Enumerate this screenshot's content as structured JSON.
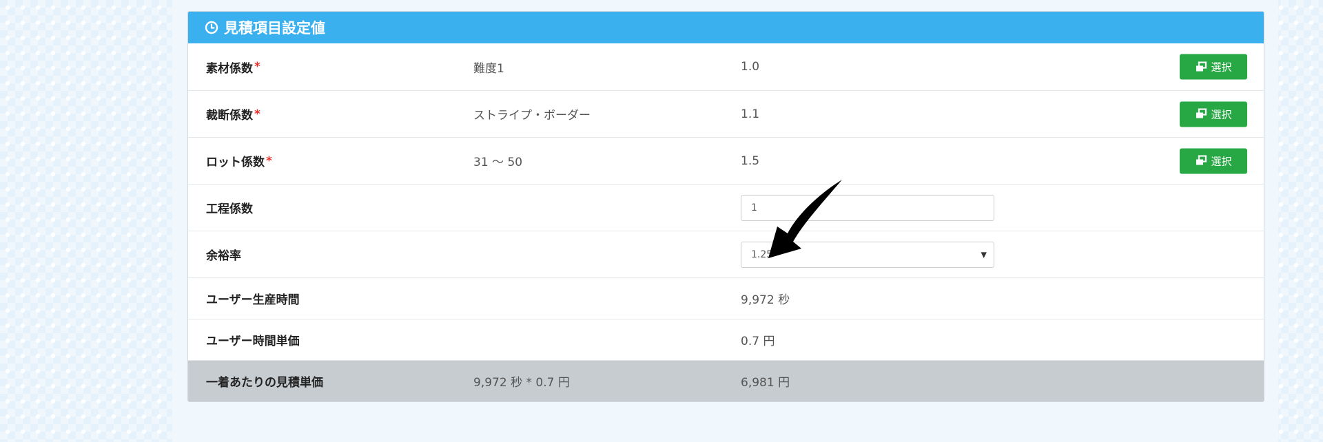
{
  "panel": {
    "title": "見積項目設定値",
    "required_mark": "*",
    "select_button_label": "選択"
  },
  "rows": [
    {
      "label": "素材係数",
      "value_name": "難度1",
      "value": "1.0"
    },
    {
      "label": "裁断係数",
      "value_name": "ストライプ・ボーダー",
      "value": "1.1"
    },
    {
      "label": "ロット係数",
      "value_name": "31 ～ 50",
      "value": "1.5"
    }
  ],
  "process_factor": {
    "label": "工程係数",
    "input_value": "1"
  },
  "margin_rate": {
    "label": "余裕率",
    "selected_value": "1.25"
  },
  "user_production_time": {
    "label": "ユーザー生産時間",
    "value": "9,972 秒"
  },
  "user_hourly_unit_price": {
    "label": "ユーザー時間単価",
    "value": "0.7 円"
  },
  "total": {
    "label": "一着あたりの見積単価",
    "formula": "9,972 秒 * 0.7 円",
    "value": "6,981 円"
  },
  "colors": {
    "header_bg": "#3bb0ee",
    "button_bg": "#28a745",
    "total_bg": "#c7ccd0",
    "required": "#e8322d"
  },
  "icons": {
    "header": "clock-icon",
    "button": "window-restore-icon",
    "select": "caret-down-icon",
    "annotation": "curved-arrow-icon"
  }
}
